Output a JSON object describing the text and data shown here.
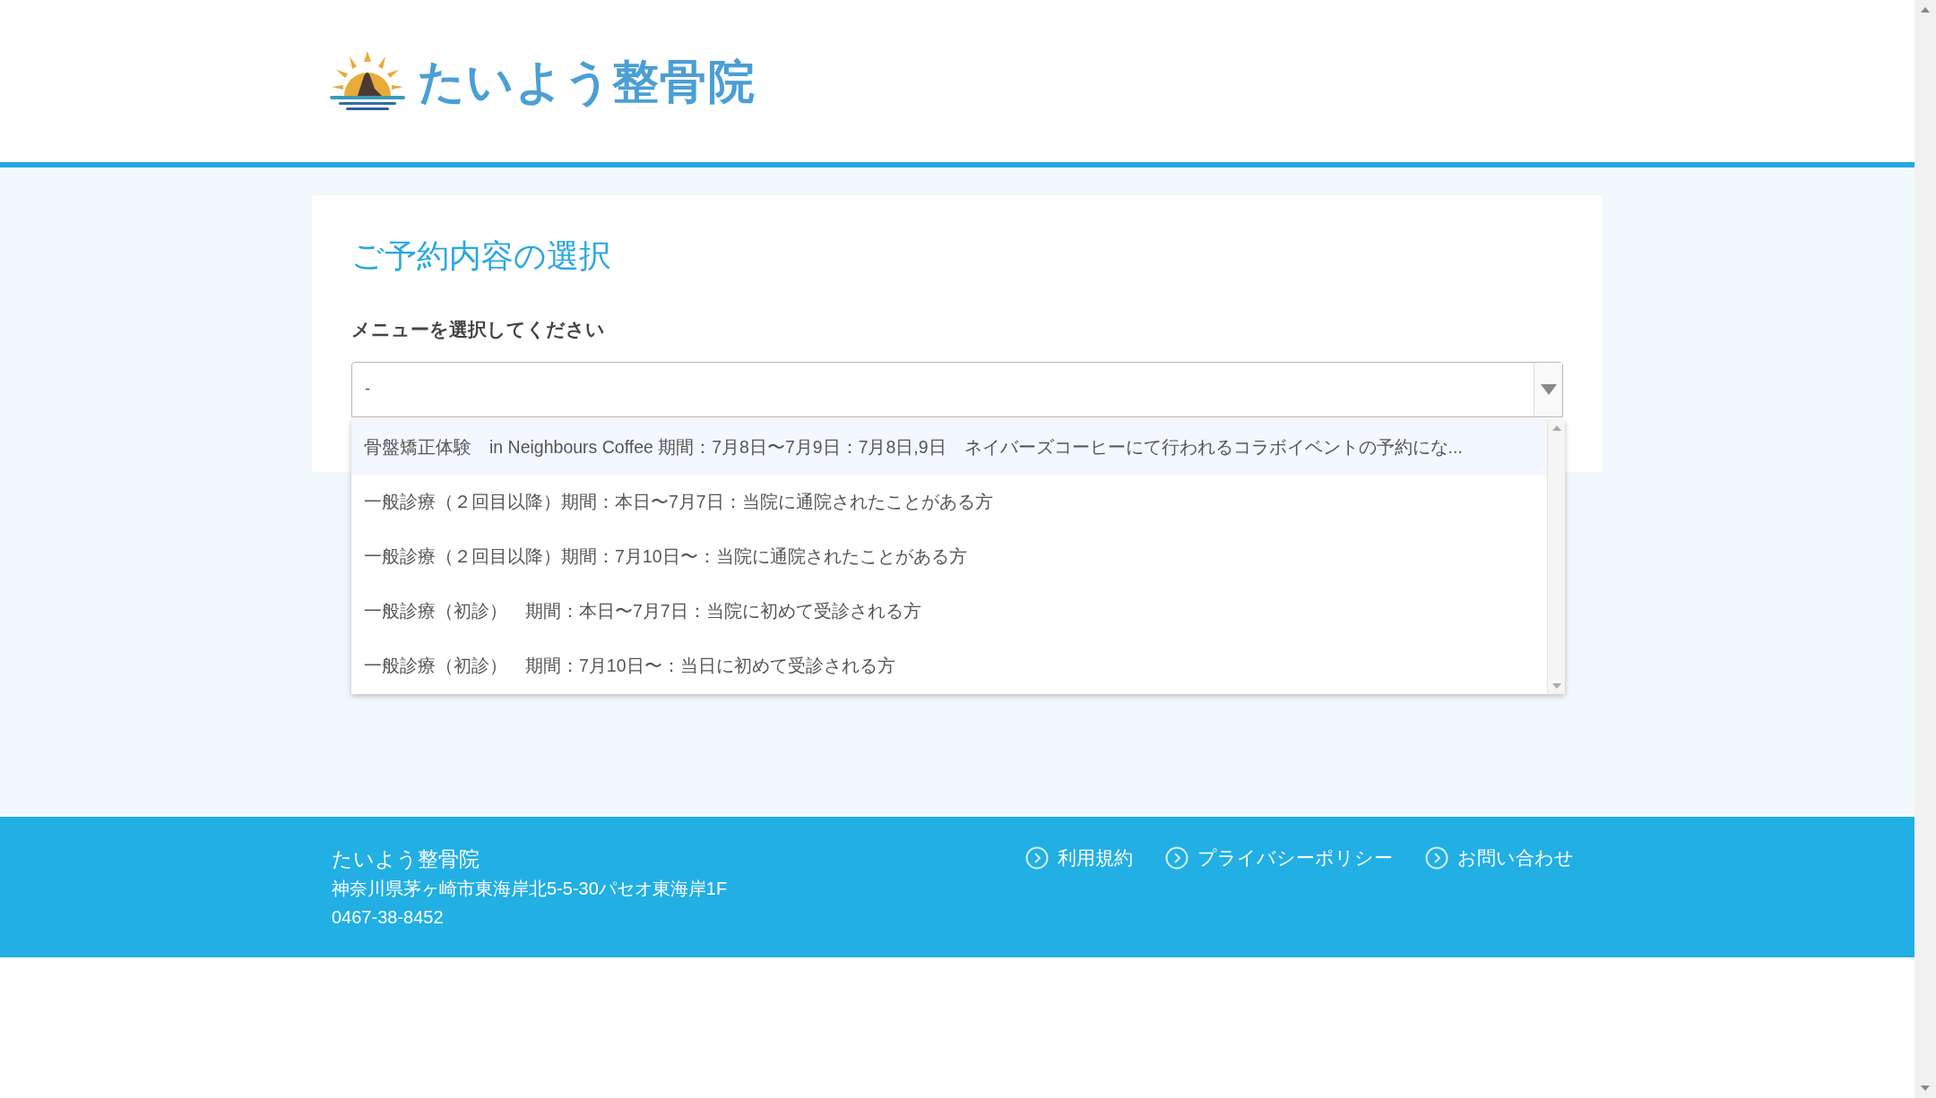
{
  "header": {
    "logo_text": "たいよう整骨院"
  },
  "card": {
    "title": "ご予約内容の選択",
    "field_label": "メニューを選択してください",
    "select": {
      "value": "-",
      "expanded": true,
      "options": [
        {
          "label": "骨盤矯正体験　in Neighbours Coffee 期間：7月8日〜7月9日：7月8日,9日　ネイバーズコーヒーにて行われるコラボイベントの予約にな...",
          "selected": true
        },
        {
          "label": "一般診療（２回目以降）期間：本日〜7月7日：当院に通院されたことがある方",
          "selected": false
        },
        {
          "label": "一般診療（２回目以降）期間：7月10日〜：当院に通院されたことがある方",
          "selected": false
        },
        {
          "label": "一般診療（初診）　期間：本日〜7月7日：当院に初めて受診される方",
          "selected": false
        },
        {
          "label": "一般診療（初診）　期間：7月10日〜：当日に初めて受診される方",
          "selected": false
        }
      ]
    }
  },
  "footer": {
    "name": "たいよう整骨院",
    "address": "神奈川県茅ヶ崎市東海岸北5-5-30パセオ東海岸1F",
    "phone": "0467-38-8452",
    "links": [
      "利用規約",
      "プライバシーポリシー",
      "お問い合わせ"
    ]
  }
}
